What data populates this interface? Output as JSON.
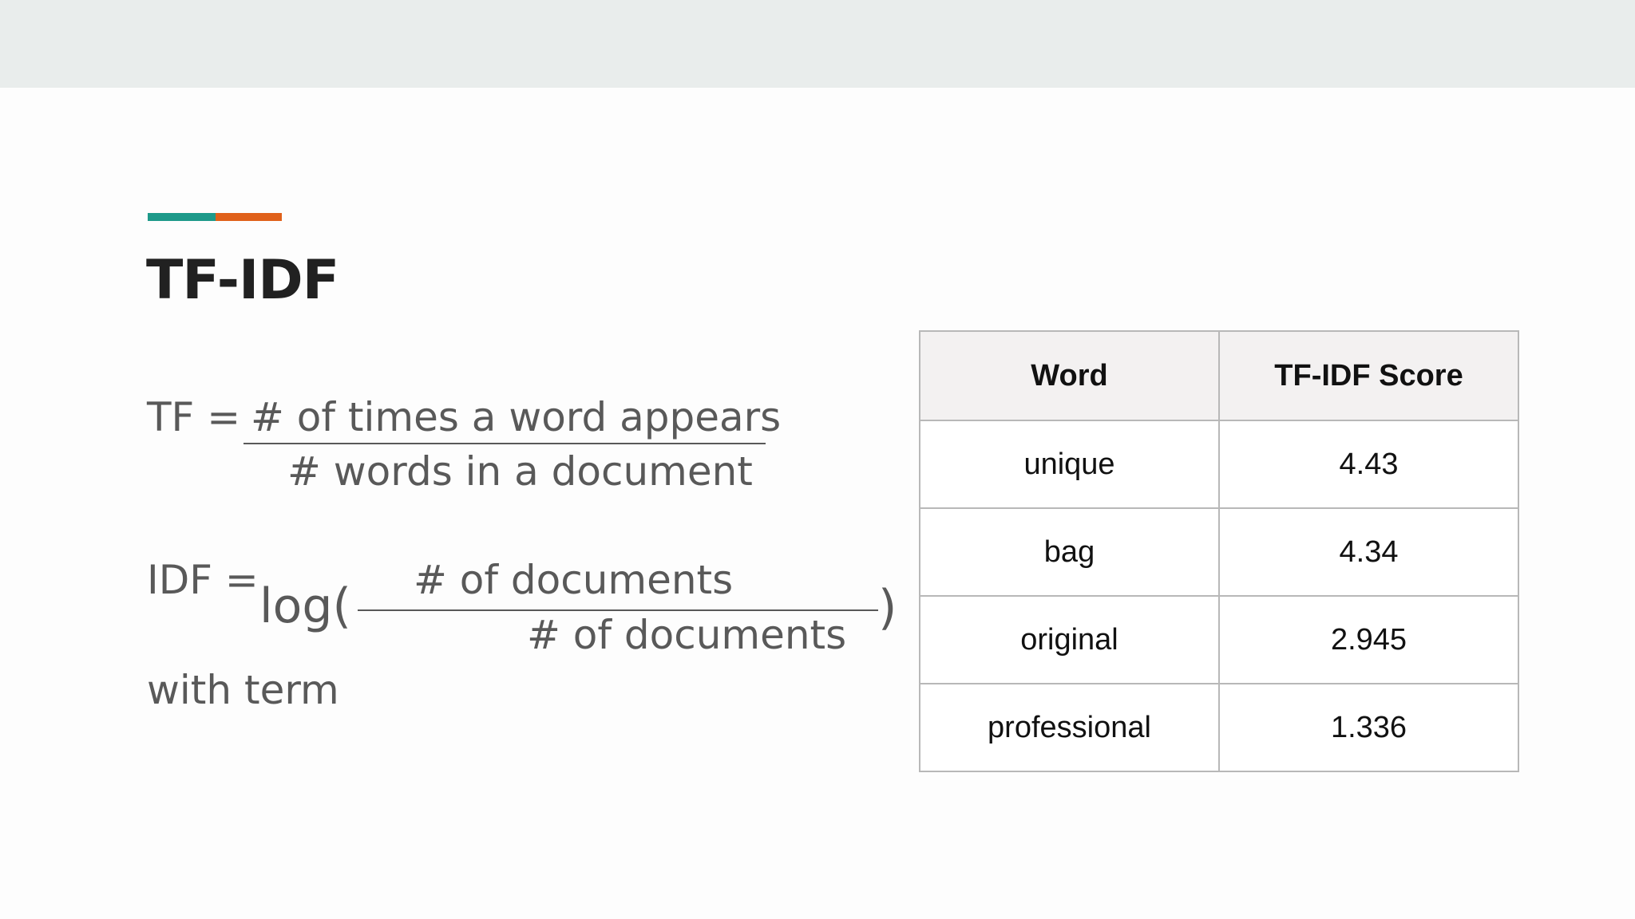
{
  "colors": {
    "accent_teal": "#1e9a8a",
    "accent_orange": "#e0611a",
    "formula_text": "#595959",
    "title_text": "#212121"
  },
  "slide": {
    "title": "TF-IDF",
    "tf_formula": {
      "label": "TF =",
      "numerator": "# of times a word appears",
      "denominator": "# words in a document"
    },
    "idf_formula": {
      "label": "IDF =",
      "log_open": "log(",
      "numerator": "# of documents",
      "denominator": "# of documents",
      "close_paren": ")",
      "continuation": "with term"
    },
    "table": {
      "headers": [
        "Word",
        "TF-IDF Score"
      ],
      "rows": [
        {
          "word": "unique",
          "score": "4.43"
        },
        {
          "word": "bag",
          "score": "4.34"
        },
        {
          "word": "original",
          "score": "2.945"
        },
        {
          "word": "professional",
          "score": "1.336"
        }
      ]
    }
  }
}
